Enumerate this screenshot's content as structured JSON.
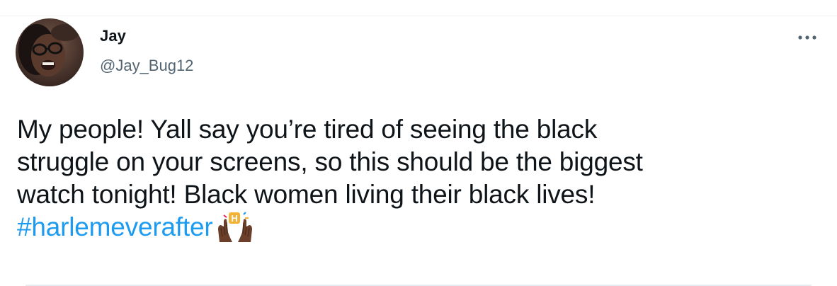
{
  "author": {
    "display_name": "Jay",
    "handle": "@Jay_Bug12",
    "avatar_icon": "user-avatar-photo"
  },
  "tweet": {
    "lines": [
      "My people! Yall say you’re tired of seeing the black",
      "struggle on your screens, so this should be the biggest",
      "watch tonight! Black women living their black lives!"
    ],
    "hashtag": "#harlemeverafter",
    "hashtag_emoji_icon": "raised-hands-dark-skin-tone-h-emoji"
  },
  "colors": {
    "text_primary": "#0f1419",
    "text_secondary": "#536471",
    "link": "#1d9bf0",
    "divider": "#eff3f4"
  },
  "menu_icon": "more-options-icon"
}
